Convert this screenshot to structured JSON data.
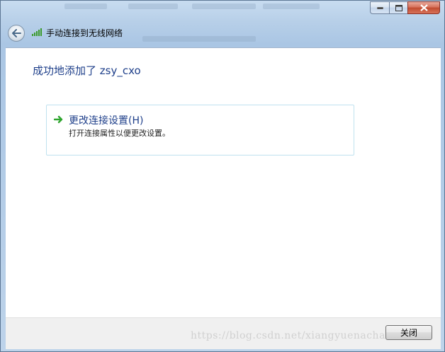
{
  "window": {
    "title": "手动连接到无线网络"
  },
  "main": {
    "heading": "成功地添加了 zsy_cxo",
    "link": {
      "title": "更改连接设置(H)",
      "description": "打开连接属性以便更改设置。"
    }
  },
  "footer": {
    "close_label": "关闭"
  },
  "watermark": "https://blog.csdn.net/xiangyuenacha",
  "icons": {
    "back": "back-arrow-icon",
    "wireless": "wireless-signal-icon",
    "link_arrow": "green-arrow-icon"
  },
  "colors": {
    "heading": "#1e3f8a",
    "link_border": "#bfe2ef",
    "arrow": "#2fa52f"
  }
}
